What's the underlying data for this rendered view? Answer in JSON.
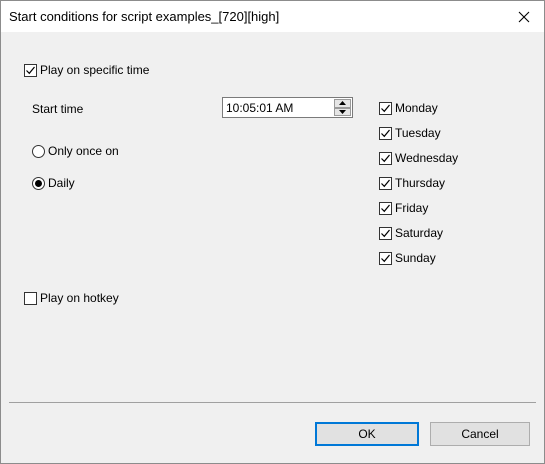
{
  "window": {
    "title": "Start conditions for script examples_[720][high]"
  },
  "play_on_time": {
    "label": "Play on specific time",
    "checked": true
  },
  "start_time": {
    "label": "Start time",
    "value": "10:05:01 AM"
  },
  "schedule": {
    "only_once_label": "Only once on",
    "daily_label": "Daily",
    "selected": "Daily"
  },
  "days": [
    {
      "label": "Monday",
      "checked": true
    },
    {
      "label": "Tuesday",
      "checked": true
    },
    {
      "label": "Wednesday",
      "checked": true
    },
    {
      "label": "Thursday",
      "checked": true
    },
    {
      "label": "Friday",
      "checked": true
    },
    {
      "label": "Saturday",
      "checked": true
    },
    {
      "label": "Sunday",
      "checked": true
    }
  ],
  "play_on_hotkey": {
    "label": "Play on hotkey",
    "checked": false
  },
  "buttons": {
    "ok": "OK",
    "cancel": "Cancel"
  },
  "colors": {
    "focus": "#0078d7",
    "background": "#f0f0f0"
  }
}
